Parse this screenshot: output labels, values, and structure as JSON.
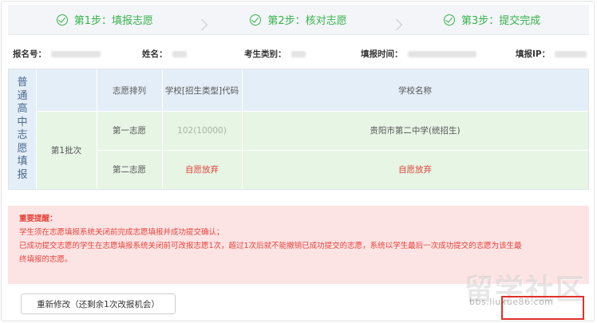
{
  "steps": [
    {
      "label": "第1步：填报志愿"
    },
    {
      "label": "第2步：核对志愿"
    },
    {
      "label": "第3步：提交完成"
    }
  ],
  "info": {
    "reg_no_label": "报名号：",
    "name_label": "姓名：",
    "category_label": "考生类别：",
    "time_label": "填报时间：",
    "ip_label": "填报IP："
  },
  "table": {
    "side_chars": [
      "普",
      "通",
      "高",
      "中",
      "志",
      "愿",
      "填",
      "报"
    ],
    "batch": "第1批次",
    "headers": {
      "order": "志愿排列",
      "code": "学校[招生类型]代码",
      "name": "学校名称"
    },
    "rows": [
      {
        "order": "第一志愿",
        "code": "102(10000)",
        "name": "贵阳市第二中学(统招生)"
      },
      {
        "order": "第二志愿",
        "code": "自愿放弃",
        "name": "自愿放弃"
      }
    ]
  },
  "notice": {
    "title": "重要提醒：",
    "lines": [
      "学生须在志愿填报系统关闭前完成志愿填报并成功提交确认；",
      "已成功提交志愿的学生在志愿填报系统关闭前可改报志愿1次，超过1次后就不能撤销已成功提交的志愿，系统以学生最后一次成功提交的志愿为该生最",
      "终填报的志愿。"
    ]
  },
  "actions": {
    "modify_button": "重新修改（还剩余1次改报机会）"
  },
  "watermark": {
    "text": "留学社区",
    "url": "bbs.liuxue86.com"
  },
  "colors": {
    "step_green": "#35b34a",
    "header_blue": "#e4eef8",
    "row_green": "#e7f5e5",
    "notice_bg": "#fde4e4",
    "notice_red": "#e8423a"
  }
}
